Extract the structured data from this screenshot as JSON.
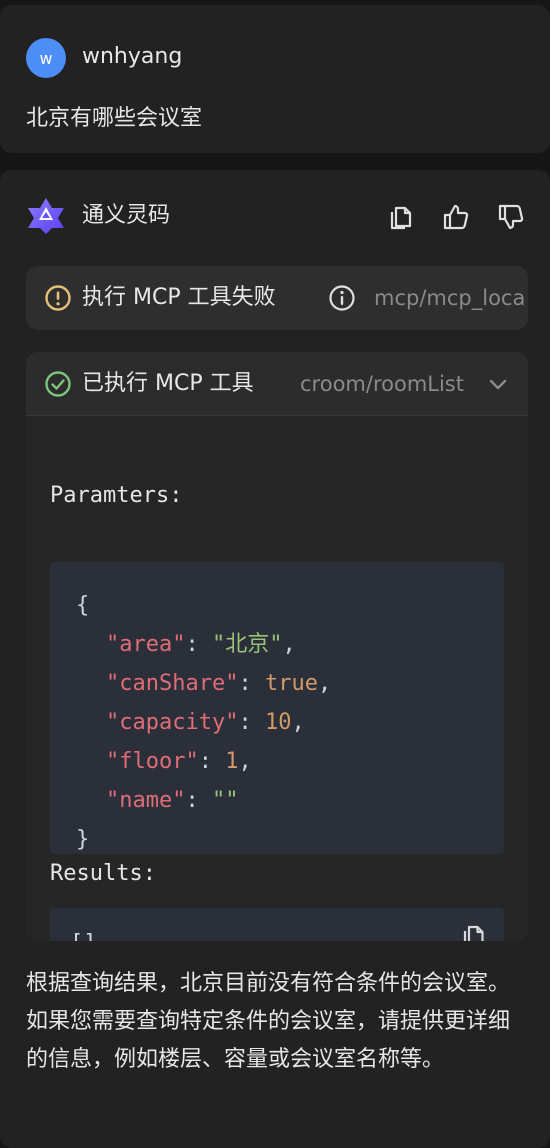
{
  "user": {
    "avatar_letter": "w",
    "avatar_color": "#4c8df6",
    "name": "wnhyang",
    "message": "北京有哪些会议室"
  },
  "assistant": {
    "logo_icon": "tongyi-lingma-logo",
    "name": "通义灵码",
    "actions": [
      "copy-icon",
      "thumbs-up-icon",
      "thumbs-down-icon"
    ],
    "failed_tool": {
      "status_icon": "warning-circle-icon",
      "status_color": "#e5c07b",
      "label": "执行 MCP 工具失败",
      "info_icon": "info-circle-icon",
      "path": "mcp/mcp_loca"
    },
    "executed_tool": {
      "status_icon": "check-circle-icon",
      "status_color": "#7ec27e",
      "label": "已执行 MCP 工具",
      "path": "croom/roomList",
      "expand_icon": "chevron-down-icon",
      "params_label": "Paramters:",
      "params": {
        "open": "{",
        "close": "}",
        "lines": [
          {
            "key": "\"area\"",
            "sep": ": ",
            "value": "\"北京\"",
            "end": ","
          },
          {
            "key": "\"canShare\"",
            "sep": ": ",
            "value": "true",
            "end": ","
          },
          {
            "key": "\"capacity\"",
            "sep": ": ",
            "value": "10",
            "end": ","
          },
          {
            "key": "\"floor\"",
            "sep": ": ",
            "value": "1",
            "end": ","
          },
          {
            "key": "\"name\"",
            "sep": ": ",
            "value": "\"\"",
            "end": ""
          }
        ]
      },
      "results_label": "Results:",
      "results_value": "[]",
      "copy_icon": "copy-icon"
    },
    "answer": "根据查询结果，北京目前没有符合条件的会议室。如果您需要查询特定条件的会议室，请提供更详细的信息，例如楼层、容量或会议室名称等。"
  }
}
